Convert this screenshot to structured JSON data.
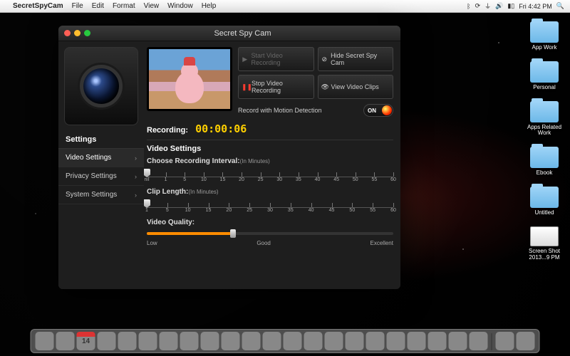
{
  "menubar": {
    "app": "SecretSpyCam",
    "items": [
      "File",
      "Edit",
      "Format",
      "View",
      "Window",
      "Help"
    ],
    "clock": "Fri 4:42 PM"
  },
  "desktop_icons": [
    {
      "label": "App Work",
      "type": "folder"
    },
    {
      "label": "Personal",
      "type": "folder"
    },
    {
      "label": "Apps Related Work",
      "type": "folder"
    },
    {
      "label": "Ebook",
      "type": "folder"
    },
    {
      "label": "Untitled",
      "type": "folder"
    },
    {
      "label": "Screen Shot 2013...9 PM",
      "type": "shot"
    }
  ],
  "window": {
    "title": "Secret Spy Cam",
    "sidebar_head": "Settings",
    "sidebar": [
      {
        "label": "Video Settings",
        "active": true
      },
      {
        "label": "Privacy Settings",
        "active": false
      },
      {
        "label": "System Settings",
        "active": false
      }
    ],
    "buttons": {
      "start": "Start Video Recording",
      "hide": "Hide Secret Spy Cam",
      "stop": "Stop Video  Recording",
      "view": "View Video Clips"
    },
    "motion_label": "Record with Motion Detection",
    "toggle_on": "ON",
    "recording_label": "Recording:",
    "recording_time": "00:00:06",
    "section_video": "Video Settings",
    "interval": {
      "label": "Choose Recording Interval:",
      "unit": "(In Minutes)",
      "ticks": [
        "nil",
        "1",
        "5",
        "10",
        "15",
        "20",
        "25",
        "30",
        "35",
        "40",
        "45",
        "50",
        "55",
        "60"
      ],
      "value_index": 0
    },
    "clip": {
      "label": "Clip Length:",
      "unit": "(In Minutes)",
      "ticks": [
        "1",
        "5",
        "10",
        "15",
        "20",
        "25",
        "30",
        "35",
        "40",
        "45",
        "50",
        "55",
        "60"
      ],
      "value_index": 0
    },
    "quality": {
      "label": "Video Quality:",
      "levels": [
        "Low",
        "Good",
        "Excellent"
      ],
      "percent": 35
    }
  }
}
